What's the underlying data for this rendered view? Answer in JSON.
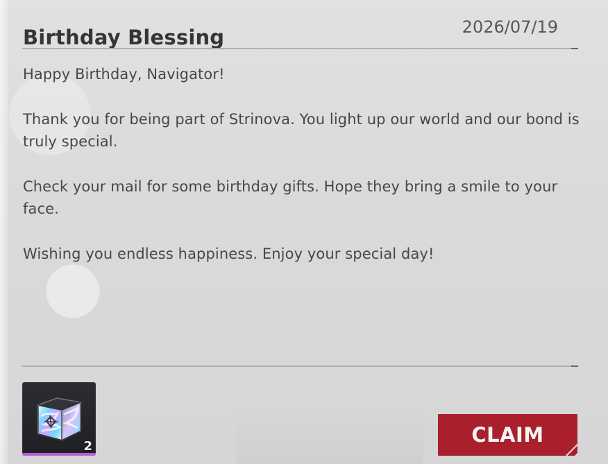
{
  "mail": {
    "title": "Birthday Blessing",
    "date": "2026/07/19",
    "body": [
      "Happy Birthday, Navigator!",
      "Thank you for being part of Strinova. You light up our world and our bond is truly special.",
      "Check your mail for some birthday gifts. Hope they bring a smile to your face.",
      "Wishing you endless happiness. Enjoy your special day!"
    ]
  },
  "reward": {
    "icon": "gift-box-icon",
    "count": "2",
    "rarity_color": "#b75ad8"
  },
  "actions": {
    "claim_label": "CLAIM",
    "claim_color": "#a9202c"
  }
}
